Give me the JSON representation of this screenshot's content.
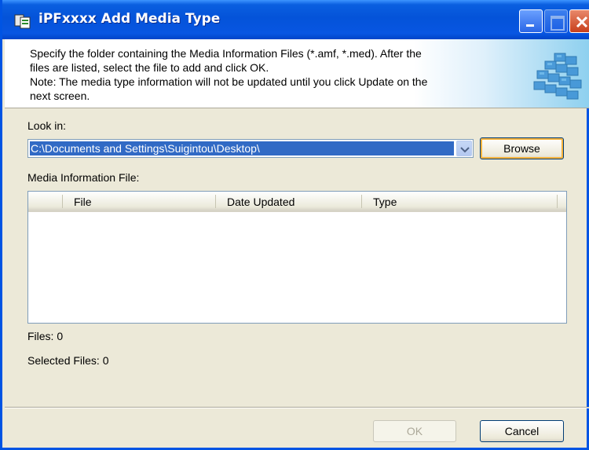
{
  "window": {
    "title": "iPFxxxx Add Media Type"
  },
  "header": {
    "instructions_line1": "Specify the folder containing the Media Information Files (*.amf, *.med). After the",
    "instructions_line2": "files are listed, select the file to add and click OK.",
    "note_line1": "Note: The media type information will not be updated until you click Update on the",
    "note_line2": "next screen."
  },
  "look_in": {
    "label": "Look in:",
    "value": "C:\\Documents and Settings\\Suigintou\\Desktop\\",
    "browse_label": "Browse"
  },
  "media_files": {
    "label": "Media Information File:",
    "columns": [
      "File",
      "Date Updated",
      "Type"
    ],
    "rows": []
  },
  "status": {
    "files_count": "Files: 0",
    "selected_count": "Selected Files: 0"
  },
  "footer": {
    "ok_label": "OK",
    "cancel_label": "Cancel"
  },
  "icons": [
    "app-icon",
    "minimize-icon",
    "maximize-icon",
    "close-icon",
    "dropdown-arrow-icon",
    "media-stack-graphic"
  ],
  "colors": {
    "titlebar": "#0453d9",
    "selection": "#316ac5",
    "dialog_bg": "#ece9d8",
    "default_button_focus": "#f8b33c"
  }
}
